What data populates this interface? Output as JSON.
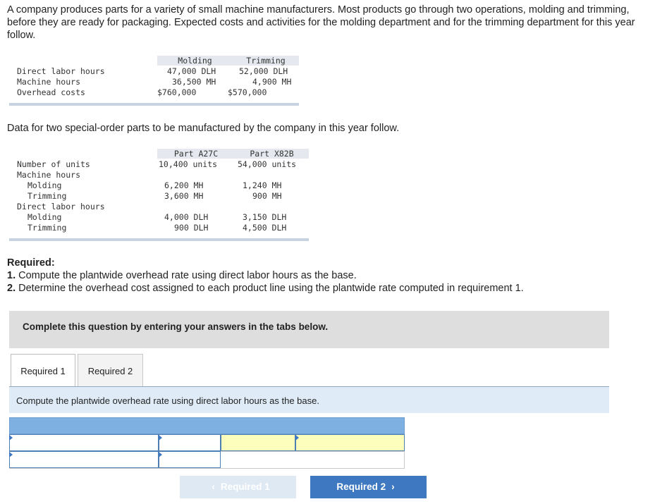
{
  "intro": "A company produces parts for a variety of small machine manufacturers. Most products go through two operations, molding and trimming, before they are ready for packaging. Expected costs and activities for the molding department and for the trimming department for this year follow.",
  "table1": {
    "headers": [
      "Molding",
      "Trimming"
    ],
    "rows": [
      {
        "label": "Direct labor hours",
        "molding": "47,000 DLH",
        "trimming": "52,000 DLH"
      },
      {
        "label": "Machine hours",
        "molding": "36,500 MH",
        "trimming": "4,900 MH"
      },
      {
        "label": "Overhead costs",
        "molding": "$760,000",
        "trimming": "$570,000"
      }
    ]
  },
  "sub_intro": "Data for two special-order parts to be manufactured by the company in this year follow.",
  "table2": {
    "headers": [
      "Part A27C",
      "Part X82B"
    ],
    "rows": [
      {
        "label": "Number of units",
        "a": "10,400 units",
        "x": "54,000 units"
      },
      {
        "label": "Machine hours",
        "a": "",
        "x": ""
      },
      {
        "label": "Molding",
        "a": "6,200 MH",
        "x": "1,240 MH"
      },
      {
        "label": "Trimming",
        "a": "3,600 MH",
        "x": "900 MH"
      },
      {
        "label": "Direct labor hours",
        "a": "",
        "x": ""
      },
      {
        "label": "Molding",
        "a": "4,000 DLH",
        "x": "3,150 DLH"
      },
      {
        "label": "Trimming",
        "a": "900 DLH",
        "x": "4,500 DLH"
      }
    ]
  },
  "required": {
    "title": "Required:",
    "items": [
      {
        "num": "1.",
        "text": "Compute the plantwide overhead rate using direct labor hours as the base."
      },
      {
        "num": "2.",
        "text": "Determine the overhead cost assigned to each product line using the plantwide rate computed in requirement 1."
      }
    ]
  },
  "banner": "Complete this question by entering your answers in the tabs below.",
  "tabs": [
    "Required 1",
    "Required 2"
  ],
  "instruction": "Compute the plantwide overhead rate using direct labor hours as the base.",
  "inputs": {
    "r1c1": "",
    "r1c2": "",
    "r1c3": "",
    "r1c4": "",
    "r2c1": "",
    "r2c2": ""
  },
  "nav": {
    "prev_label": "Required 1",
    "next_label": "Required 2",
    "prev_icon": "chevron-left-icon",
    "next_icon": "chevron-right-icon"
  },
  "colors": {
    "accent": "#3d78c0",
    "header_blue": "#7fb0e2",
    "input_yellow": "#fefebc",
    "instruction_bg": "#dfecf8"
  }
}
